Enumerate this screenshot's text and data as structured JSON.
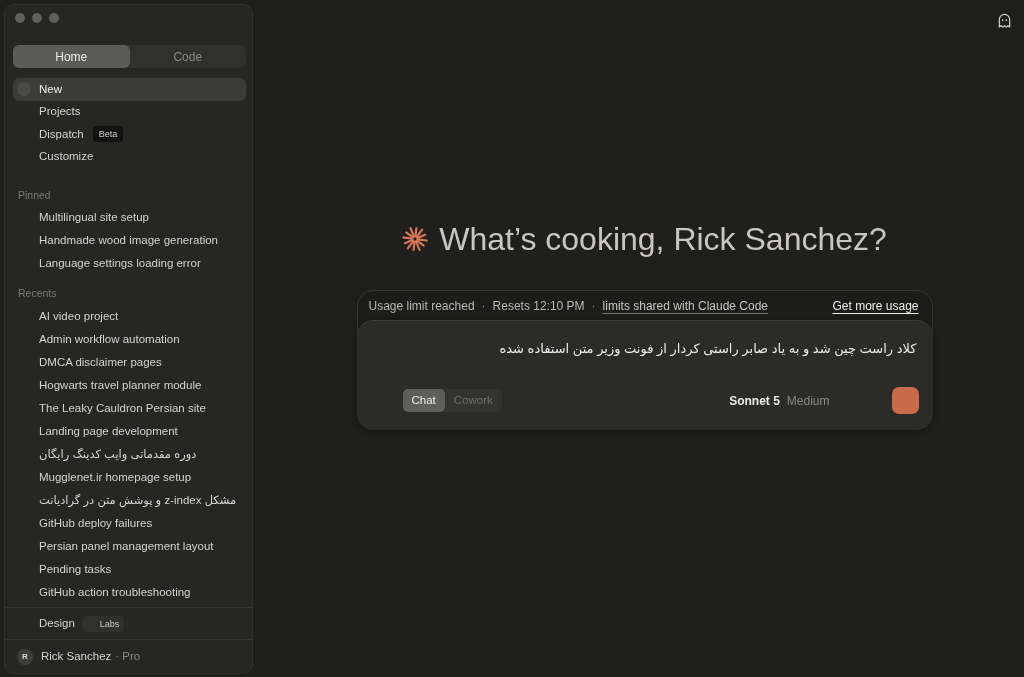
{
  "sidebar": {
    "mode_tabs": [
      {
        "label": "Home",
        "selected": true
      },
      {
        "label": "Code",
        "selected": false
      }
    ],
    "nav_items": [
      {
        "label": "New",
        "selected": true
      },
      {
        "label": "Projects",
        "selected": false
      },
      {
        "label": "Dispatch",
        "badge": "Beta",
        "selected": false
      },
      {
        "label": "Customize",
        "selected": false
      }
    ],
    "sections": [
      {
        "title": "Pinned",
        "items": [
          "Multilingual site setup",
          "Handmade wood image generation",
          "Language settings loading error"
        ]
      },
      {
        "title": "Recents",
        "items": [
          "AI video project",
          "Admin workflow automation",
          "DMCA disclaimer pages",
          "Hogwarts travel planner module",
          "The Leaky Cauldron Persian site",
          "Landing page development",
          "دوره مقدماتی وایب کدینگ رایگان",
          "Mugglenet.ir homepage setup",
          "مشکل z-index و پوشش متن در گرادیانت",
          "GitHub deploy failures",
          "Persian panel management layout",
          "Pending tasks",
          "GitHub action troubleshooting"
        ]
      }
    ],
    "footer_items": [
      {
        "label": "Design",
        "badge": "Labs"
      }
    ],
    "user": {
      "initial": "R",
      "name": "Rick Sanchez",
      "plan": "· Pro"
    }
  },
  "main": {
    "greeting": "What’s cooking, Rick Sanchez?",
    "usage_banner": {
      "parts": [
        {
          "kind": "text",
          "text": "Usage limit reached"
        },
        {
          "kind": "separator",
          "text": "·"
        },
        {
          "kind": "text",
          "text": "Resets 12:10 PM"
        },
        {
          "kind": "separator",
          "text": "·"
        },
        {
          "kind": "link",
          "text": "limits shared with Claude Code"
        }
      ],
      "action": "Get more usage"
    },
    "composer": {
      "value": "کلاد راست چین شد و به یاد صابر راستی کردار از فونت وزیر متن استفاده شده",
      "modes": [
        {
          "label": "Chat",
          "selected": true
        },
        {
          "label": "Cowork",
          "selected": false
        }
      ],
      "model": "Sonnet 5",
      "effort": "Medium"
    }
  }
}
